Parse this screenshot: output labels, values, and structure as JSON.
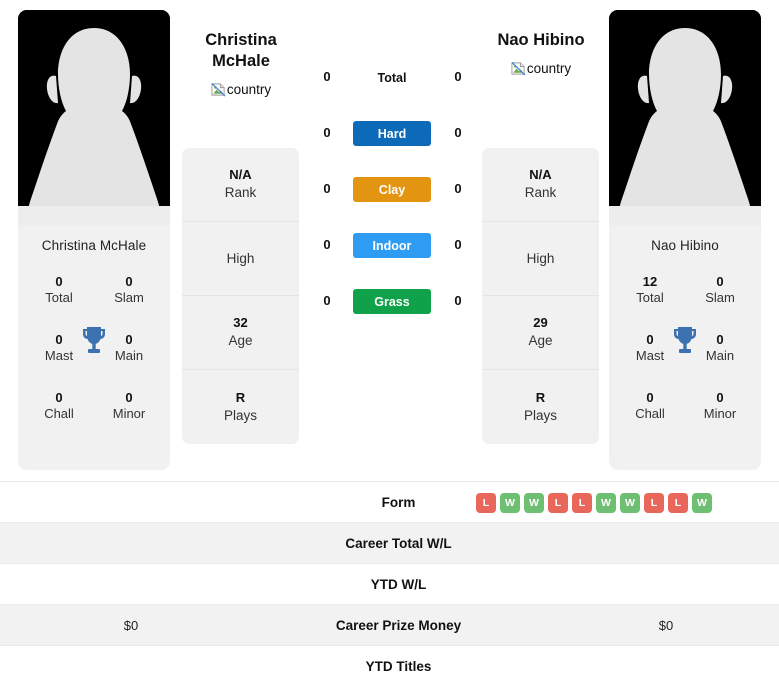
{
  "players": {
    "left": {
      "first_name": "Christina",
      "last_name": "McHale",
      "display_name": "Christina McHale",
      "country_alt": "country",
      "titles": {
        "total": {
          "value": "0",
          "label": "Total"
        },
        "slam": {
          "value": "0",
          "label": "Slam"
        },
        "mast": {
          "value": "0",
          "label": "Mast"
        },
        "main": {
          "value": "0",
          "label": "Main"
        },
        "chall": {
          "value": "0",
          "label": "Chall"
        },
        "minor": {
          "value": "0",
          "label": "Minor"
        }
      },
      "info": [
        {
          "value": "N/A",
          "label": "Rank"
        },
        {
          "value": "",
          "label": "High"
        },
        {
          "value": "32",
          "label": "Age"
        },
        {
          "value": "R",
          "label": "Plays"
        }
      ]
    },
    "right": {
      "first_name": "Nao Hibino",
      "last_name": "",
      "display_name": "Nao Hibino",
      "country_alt": "country",
      "titles": {
        "total": {
          "value": "12",
          "label": "Total"
        },
        "slam": {
          "value": "0",
          "label": "Slam"
        },
        "mast": {
          "value": "0",
          "label": "Mast"
        },
        "main": {
          "value": "0",
          "label": "Main"
        },
        "chall": {
          "value": "0",
          "label": "Chall"
        },
        "minor": {
          "value": "0",
          "label": "Minor"
        }
      },
      "info": [
        {
          "value": "N/A",
          "label": "Rank"
        },
        {
          "value": "",
          "label": "High"
        },
        {
          "value": "29",
          "label": "Age"
        },
        {
          "value": "R",
          "label": "Plays"
        }
      ]
    }
  },
  "surfaces": [
    {
      "key": "total",
      "label": "Total",
      "left": "0",
      "right": "0",
      "color": "",
      "is_badge": false
    },
    {
      "key": "hard",
      "label": "Hard",
      "left": "0",
      "right": "0",
      "color": "#0d6ab8",
      "is_badge": true
    },
    {
      "key": "clay",
      "label": "Clay",
      "left": "0",
      "right": "0",
      "color": "#e39410",
      "is_badge": true
    },
    {
      "key": "indoor",
      "label": "Indoor",
      "left": "0",
      "right": "0",
      "color": "#2f9cf4",
      "is_badge": true
    },
    {
      "key": "grass",
      "label": "Grass",
      "left": "0",
      "right": "0",
      "color": "#10a24a",
      "is_badge": true
    }
  ],
  "stats_table": [
    {
      "label": "Form",
      "left": "",
      "right": "",
      "striped": false,
      "type": "form"
    },
    {
      "label": "Career Total W/L",
      "left": "",
      "right": "",
      "striped": true,
      "type": "text"
    },
    {
      "label": "YTD W/L",
      "left": "",
      "right": "",
      "striped": false,
      "type": "text"
    },
    {
      "label": "Career Prize Money",
      "left": "$0",
      "right": "$0",
      "striped": true,
      "type": "text"
    },
    {
      "label": "YTD Titles",
      "left": "",
      "right": "",
      "striped": false,
      "type": "text"
    }
  ],
  "form_badges": [
    {
      "result": "L"
    },
    {
      "result": "W"
    },
    {
      "result": "W"
    },
    {
      "result": "L"
    },
    {
      "result": "L"
    },
    {
      "result": "W"
    },
    {
      "result": "W"
    },
    {
      "result": "L"
    },
    {
      "result": "L"
    },
    {
      "result": "W"
    }
  ],
  "colors": {
    "win": "#6fbf73",
    "loss": "#e8675a",
    "hard": "#0d6ab8",
    "clay": "#e39410",
    "indoor": "#2f9cf4",
    "grass": "#10a24a",
    "trophy": "#3d72b0",
    "card_bg": "#f1f1f1",
    "stripe_bg": "#f2f2f2"
  }
}
